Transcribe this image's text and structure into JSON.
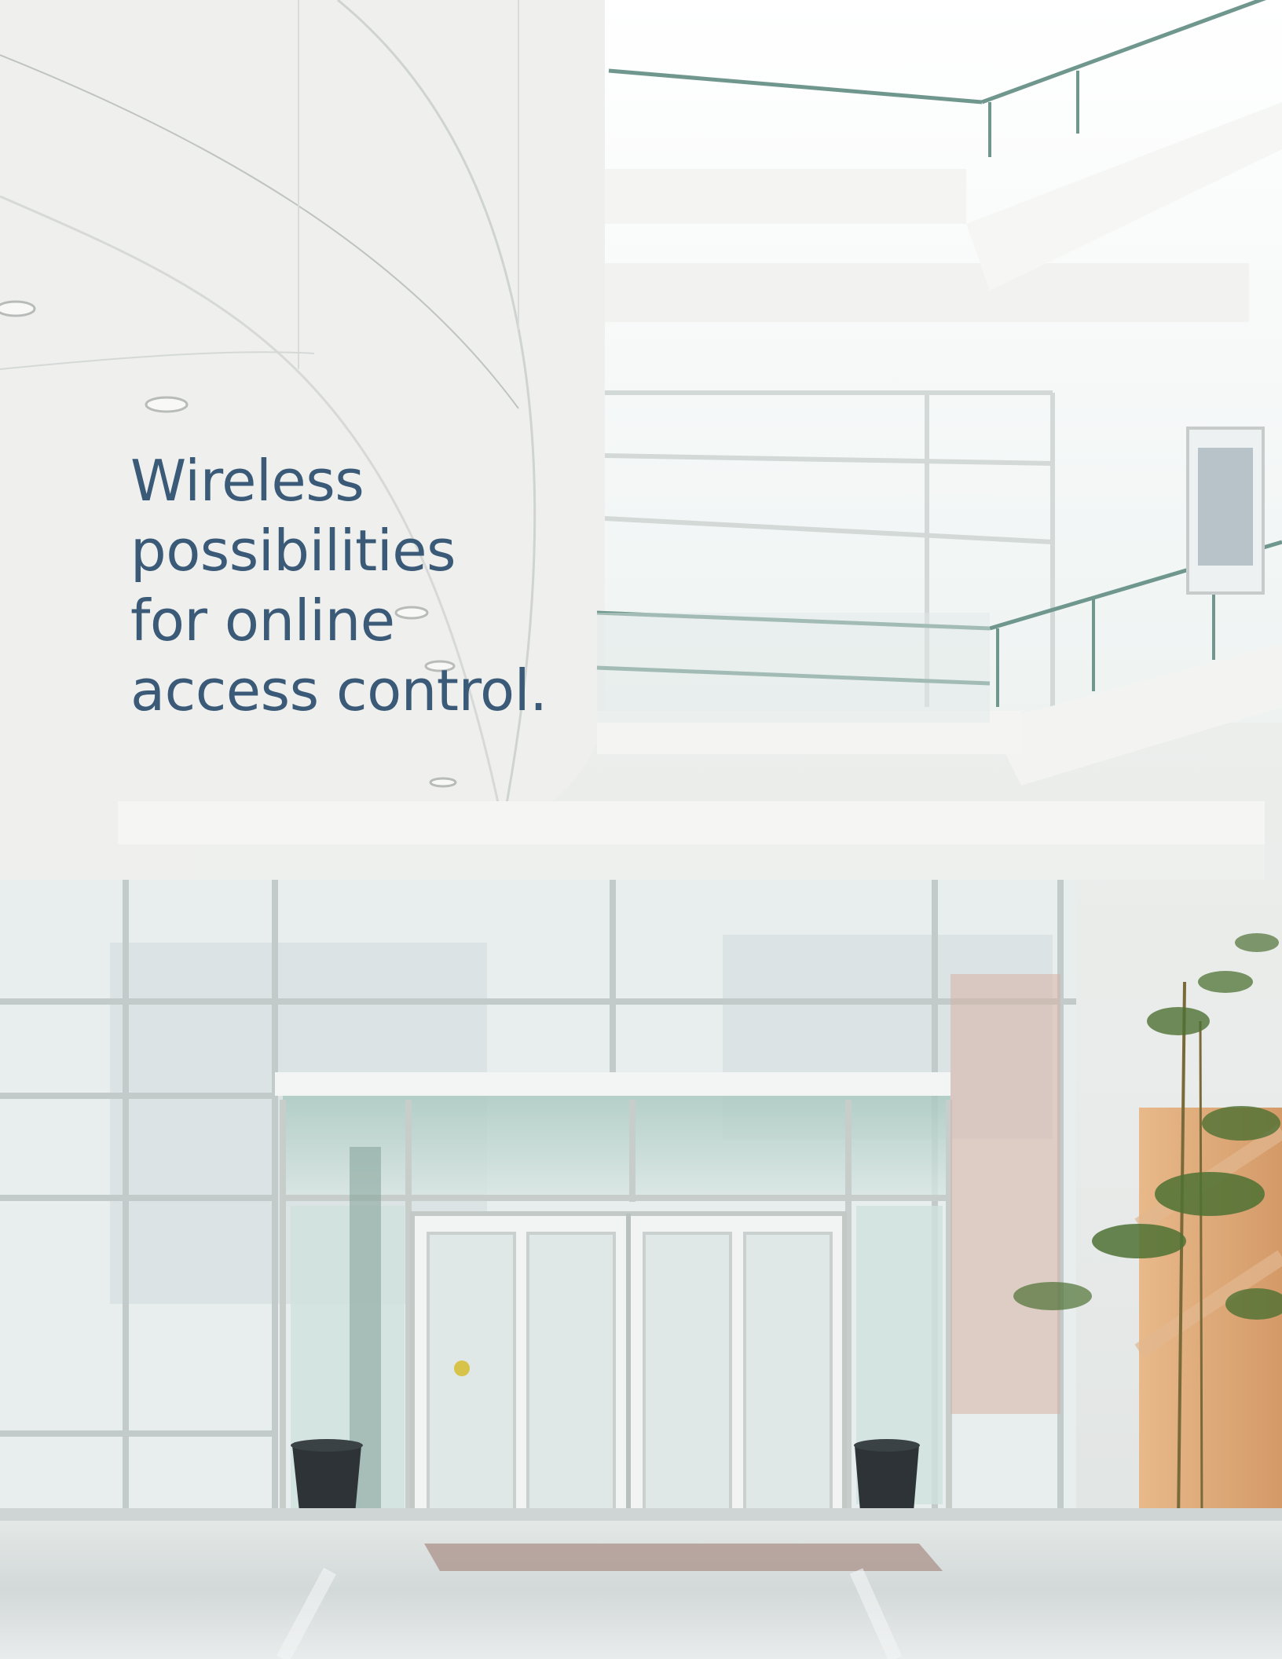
{
  "headline": {
    "lines": [
      "Wireless",
      "possibilities",
      "for online",
      "access control."
    ]
  },
  "colors": {
    "headline_text": "#3a5a78",
    "ceiling": "#f0f1ef",
    "glass": "#e2ecea",
    "frame": "#c9d0ce",
    "railing": "#5e8a80",
    "floor": "#dde2e1",
    "plant": "#4a6a2a",
    "wood_panel": "#d9a878",
    "bin": "#2d3337"
  },
  "photo": {
    "subject": "bright atrium lobby with glass entrance doors, balconies, plant and wood panel"
  }
}
